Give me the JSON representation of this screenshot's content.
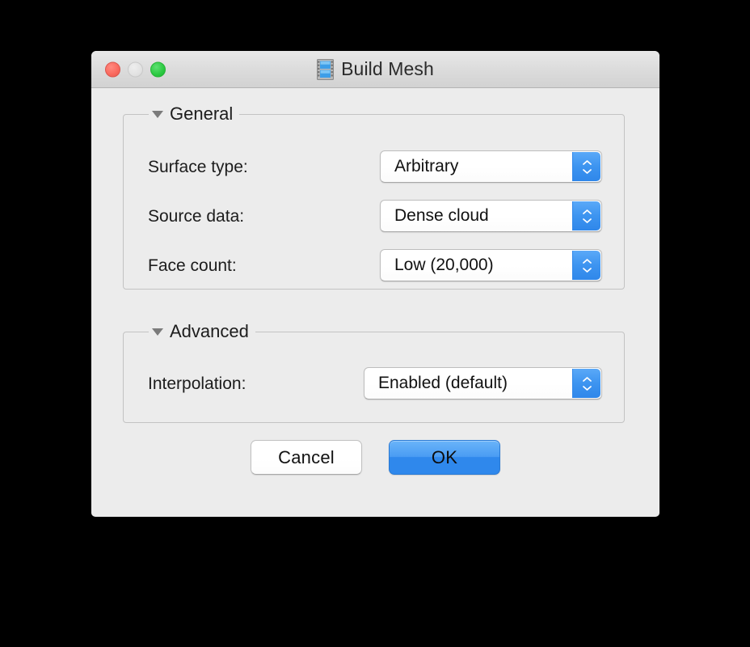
{
  "window": {
    "title": "Build Mesh",
    "icon": "mesh-document-icon",
    "traffic_lights": {
      "close": "close-button",
      "minimize": "minimize-button",
      "zoom": "zoom-button"
    }
  },
  "groups": [
    {
      "id": "general",
      "title": "General",
      "disclosure": "expanded",
      "rows": [
        {
          "label": "Surface type:",
          "value": "Arbitrary"
        },
        {
          "label": "Source data:",
          "value": "Dense cloud"
        },
        {
          "label": "Face count:",
          "value": "Low (20,000)"
        }
      ]
    },
    {
      "id": "advanced",
      "title": "Advanced",
      "disclosure": "expanded",
      "rows": [
        {
          "label": "Interpolation:",
          "value": "Enabled (default)"
        }
      ]
    }
  ],
  "buttons": {
    "cancel": "Cancel",
    "ok": "OK"
  },
  "colors": {
    "accent": "#2f88ec",
    "window_bg": "#ececec",
    "titlebar_bg": "#dcdcdc",
    "close": "#fa6b60",
    "minimize": "#e2e2e2",
    "zoom": "#2fcb45",
    "desktop": "#000000"
  }
}
